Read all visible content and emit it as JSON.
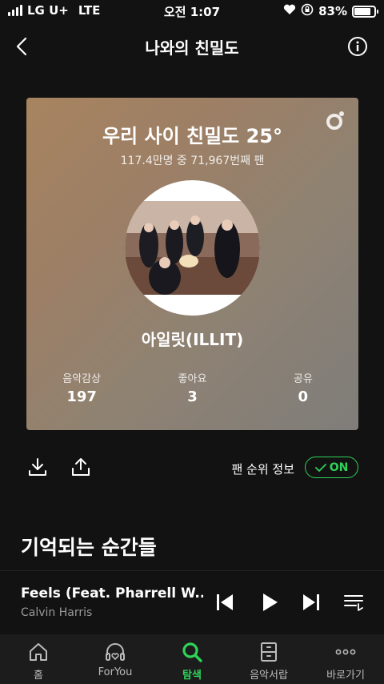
{
  "status_bar": {
    "carrier": "LG U+",
    "network": "LTE",
    "time": "오전 1:07",
    "battery_percent": "83%",
    "battery_level": 0.83
  },
  "nav": {
    "title": "나와의 친밀도"
  },
  "card": {
    "headline_prefix": "우리 사이 친밀도 ",
    "headline_value": "25°",
    "subtitle": "117.4만명 중 71,967번째 팬",
    "artist": "아일릿(ILLIT)",
    "stats": [
      {
        "label": "음악감상",
        "value": "197"
      },
      {
        "label": "좋아요",
        "value": "3"
      },
      {
        "label": "공유",
        "value": "0"
      }
    ]
  },
  "actions": {
    "fan_rank_label": "팬 순위 정보",
    "toggle_label": "ON"
  },
  "section": {
    "title": "기억되는 순간들"
  },
  "player": {
    "song_title": "Feels (Feat. Pharrell W...",
    "artist": "Calvin Harris"
  },
  "tabs": [
    {
      "label": "홈",
      "icon": "home-icon",
      "active": false
    },
    {
      "label": "ForYou",
      "icon": "headphones-heart-icon",
      "active": false
    },
    {
      "label": "탐색",
      "icon": "search-icon",
      "active": true
    },
    {
      "label": "음악서랍",
      "icon": "drawer-icon",
      "active": false
    },
    {
      "label": "바로가기",
      "icon": "more-icon",
      "active": false
    }
  ],
  "colors": {
    "accent": "#2fd35a",
    "background": "#121212"
  }
}
